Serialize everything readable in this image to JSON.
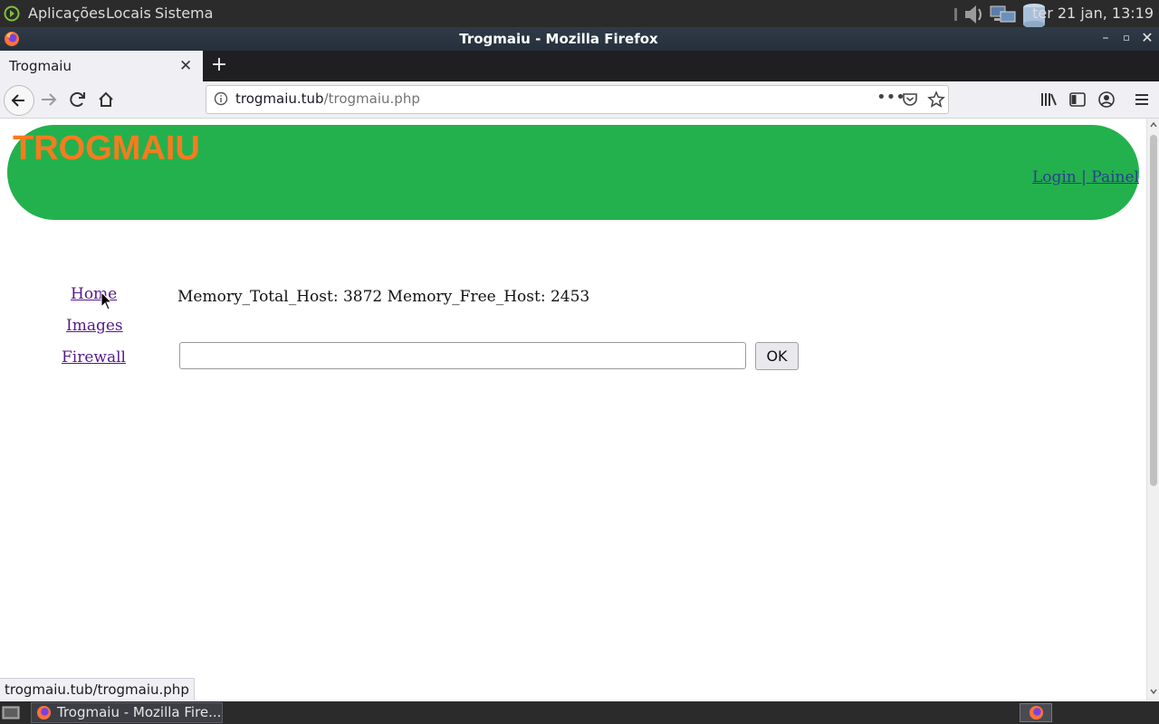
{
  "desktop": {
    "menus": [
      "Aplicações",
      "Locais",
      "Sistema"
    ],
    "clock": "ter 21 jan, 13:19"
  },
  "window": {
    "title": "Trogmaiu - Mozilla Firefox"
  },
  "tabs": [
    {
      "label": "Trogmaiu",
      "active": true
    }
  ],
  "navbar": {
    "url_host": "trogmaiu.tub",
    "url_path": "/trogmaiu.php"
  },
  "page": {
    "site_title": "TROGMAIU",
    "login_link": "Login | Painel",
    "nav_links": [
      "Home",
      "Images",
      "Firewall"
    ],
    "memory_text": "Memory_Total_Host: 3872 Memory_Free_Host: 2453",
    "command_input": {
      "value": "",
      "placeholder": ""
    },
    "ok_button": "OK"
  },
  "status_bar": {
    "url": "trogmaiu.tub/trogmaiu.php"
  },
  "taskbar": {
    "item_label": "Trogmaiu - Mozilla Fire..."
  },
  "colors": {
    "banner": "#23b14d",
    "title": "#f47c20",
    "visited_link": "#551a8b",
    "link": "#2b3f8f"
  }
}
